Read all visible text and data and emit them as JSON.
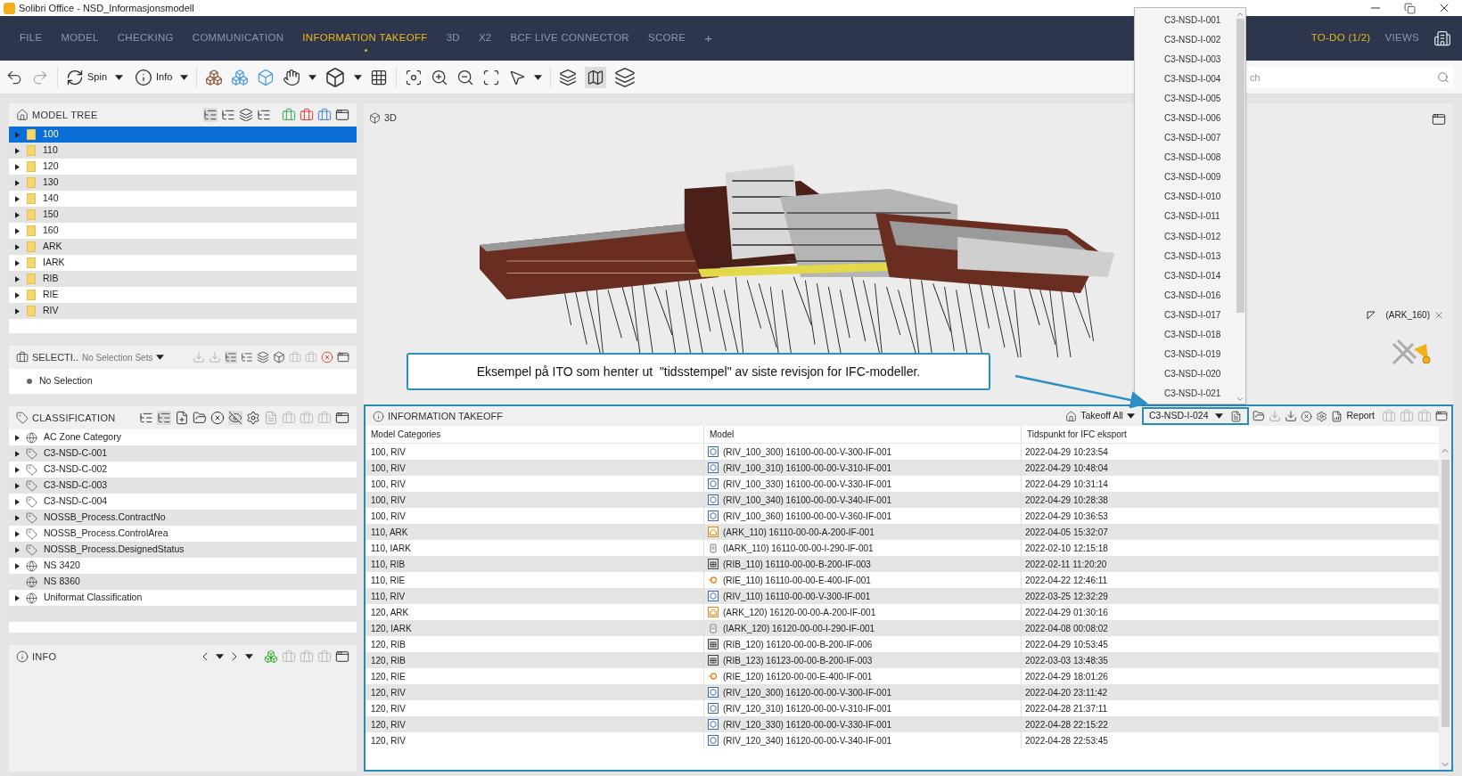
{
  "window": {
    "title": "Solibri Office - NSD_Informasjonsmodell"
  },
  "nav": {
    "tabs": [
      {
        "label": "FILE",
        "selected": false
      },
      {
        "label": "MODEL",
        "selected": false
      },
      {
        "label": "CHECKING",
        "selected": false
      },
      {
        "label": "COMMUNICATION",
        "selected": false
      },
      {
        "label": "INFORMATION TAKEOFF",
        "selected": true
      },
      {
        "label": "3D",
        "selected": false
      },
      {
        "label": "X2",
        "selected": false
      },
      {
        "label": "BCF LIVE CONNECTOR",
        "selected": false
      },
      {
        "label": "SCORE",
        "selected": false
      }
    ],
    "plus": "+",
    "todo": "TO-DO (1/2)",
    "views": "VIEWS"
  },
  "toolbar": {
    "spin": "Spin",
    "info": "Info",
    "search": {
      "placeholder": "ch"
    }
  },
  "model_tree": {
    "title": "MODEL TREE",
    "items": [
      {
        "label": "100",
        "selected": true
      },
      {
        "label": "110",
        "selected": false
      },
      {
        "label": "120",
        "selected": false
      },
      {
        "label": "130",
        "selected": false
      },
      {
        "label": "140",
        "selected": false
      },
      {
        "label": "150",
        "selected": false
      },
      {
        "label": "160",
        "selected": false
      },
      {
        "label": "ARK",
        "selected": false
      },
      {
        "label": "IARK",
        "selected": false
      },
      {
        "label": "RIB",
        "selected": false
      },
      {
        "label": "RIE",
        "selected": false
      },
      {
        "label": "RIV",
        "selected": false
      }
    ]
  },
  "selection_sets": {
    "title": "SELECTI..",
    "dropdown": "No Selection Sets",
    "items": [
      "No Selection"
    ]
  },
  "classification": {
    "title": "CLASSIFICATION",
    "items": [
      {
        "label": "AC Zone Category",
        "kind": "globe",
        "has_children": true
      },
      {
        "label": "C3-NSD-C-001",
        "kind": "tag",
        "has_children": true
      },
      {
        "label": "C3-NSD-C-002",
        "kind": "tag",
        "has_children": true
      },
      {
        "label": "C3-NSD-C-003",
        "kind": "tag",
        "has_children": true
      },
      {
        "label": "C3-NSD-C-004",
        "kind": "tag",
        "has_children": true
      },
      {
        "label": "NOSSB_Process.ContractNo",
        "kind": "tag",
        "has_children": true
      },
      {
        "label": "NOSSB_Process.ControlArea",
        "kind": "tag",
        "has_children": true
      },
      {
        "label": "NOSSB_Process.DesignedStatus",
        "kind": "tag",
        "has_children": true
      },
      {
        "label": "NS 3420",
        "kind": "globe",
        "has_children": true
      },
      {
        "label": "NS 8360",
        "kind": "globe",
        "has_children": false
      },
      {
        "label": "Uniformat Classification",
        "kind": "globe",
        "has_children": true
      }
    ]
  },
  "info_panel": {
    "title": "INFO"
  },
  "view_3d": {
    "title": "3D",
    "model_label": "(ARK_160)",
    "callout": "Eksempel på ITO som henter ut  \"tidsstempel\" av siste revisjon for IFC-modeller."
  },
  "takeoff": {
    "title": "INFORMATION TAKEOFF",
    "takeoff_all": "Takeoff All",
    "selected_takeoff": "C3-NSD-I-024",
    "report": "Report",
    "columns": [
      "Model Categories",
      "Model",
      "Tidspunkt for IFC eksport"
    ],
    "rows": [
      {
        "category": "100, RIV",
        "kind": "riv",
        "model": "(RIV_100_300) 16100-00-00-V-300-IF-001",
        "timestamp": "2022-04-29 10:23:54"
      },
      {
        "category": "100, RIV",
        "kind": "riv",
        "model": "(RIV_100_310) 16100-00-00-V-310-IF-001",
        "timestamp": "2022-04-29 10:48:04"
      },
      {
        "category": "100, RIV",
        "kind": "riv",
        "model": "(RIV_100_330) 16100-00-00-V-330-IF-001",
        "timestamp": "2022-04-29 10:31:14"
      },
      {
        "category": "100, RIV",
        "kind": "riv",
        "model": "(RIV_100_340) 16100-00-00-V-340-IF-001",
        "timestamp": "2022-04-29 10:28:38"
      },
      {
        "category": "100, RIV",
        "kind": "riv",
        "model": "(RIV_100_360) 16100-00-00-V-360-IF-001",
        "timestamp": "2022-04-29 10:36:53"
      },
      {
        "category": "110, ARK",
        "kind": "ark",
        "model": "(ARK_110) 16110-00-00-A-200-IF-001",
        "timestamp": "2022-04-05 15:32:07"
      },
      {
        "category": "110, IARK",
        "kind": "iark",
        "model": "(IARK_110) 16110-00-00-I-290-IF-001",
        "timestamp": "2022-02-10 12:15:18"
      },
      {
        "category": "110, RIB",
        "kind": "rib",
        "model": "(RIB_110) 16110-00-00-B-200-IF-003",
        "timestamp": "2022-02-11 11:20:20"
      },
      {
        "category": "110, RIE",
        "kind": "rie",
        "model": "(RIE_110) 16110-00-00-E-400-IF-001",
        "timestamp": "2022-04-22 12:46:11"
      },
      {
        "category": "110, RIV",
        "kind": "riv",
        "model": "(RIV_110) 16110-00-00-V-300-IF-001",
        "timestamp": "2022-03-25 12:32:29"
      },
      {
        "category": "120, ARK",
        "kind": "ark",
        "model": "(ARK_120) 16120-00-00-A-200-IF-001",
        "timestamp": "2022-04-29 01:30:16"
      },
      {
        "category": "120, IARK",
        "kind": "iark",
        "model": "(IARK_120) 16120-00-00-I-290-IF-001",
        "timestamp": "2022-04-08 00:08:02"
      },
      {
        "category": "120, RIB",
        "kind": "rib",
        "model": "(RIB_120) 16120-00-00-B-200-IF-006",
        "timestamp": "2022-04-29 10:53:45"
      },
      {
        "category": "120, RIB",
        "kind": "rib",
        "model": "(RIB_123) 16123-00-00-B-200-IF-003",
        "timestamp": "2022-03-03 13:48:35"
      },
      {
        "category": "120, RIE",
        "kind": "rie",
        "model": "(RIE_120) 16120-00-00-E-400-IF-001",
        "timestamp": "2022-04-29 18:01:26"
      },
      {
        "category": "120, RIV",
        "kind": "riv",
        "model": "(RIV_120_300) 16120-00-00-V-300-IF-001",
        "timestamp": "2022-04-20 23:11:42"
      },
      {
        "category": "120, RIV",
        "kind": "riv",
        "model": "(RIV_120_310) 16120-00-00-V-310-IF-001",
        "timestamp": "2022-04-28 21:37:11"
      },
      {
        "category": "120, RIV",
        "kind": "riv",
        "model": "(RIV_120_330) 16120-00-00-V-330-IF-001",
        "timestamp": "2022-04-28 22:15:22"
      },
      {
        "category": "120, RIV",
        "kind": "riv",
        "model": "(RIV_120_340) 16120-00-00-V-340-IF-001",
        "timestamp": "2022-04-28 22:53:45"
      }
    ]
  },
  "takeoff_dropdown": {
    "options": [
      "C3-NSD-I-001",
      "C3-NSD-I-002",
      "C3-NSD-I-003",
      "C3-NSD-I-004",
      "C3-NSD-I-005",
      "C3-NSD-I-006",
      "C3-NSD-I-007",
      "C3-NSD-I-008",
      "C3-NSD-I-009",
      "C3-NSD-I-010",
      "C3-NSD-I-011",
      "C3-NSD-I-012",
      "C3-NSD-I-013",
      "C3-NSD-I-014",
      "C3-NSD-I-016",
      "C3-NSD-I-017",
      "C3-NSD-I-018",
      "C3-NSD-I-019",
      "C3-NSD-I-020",
      "C3-NSD-I-021"
    ]
  }
}
